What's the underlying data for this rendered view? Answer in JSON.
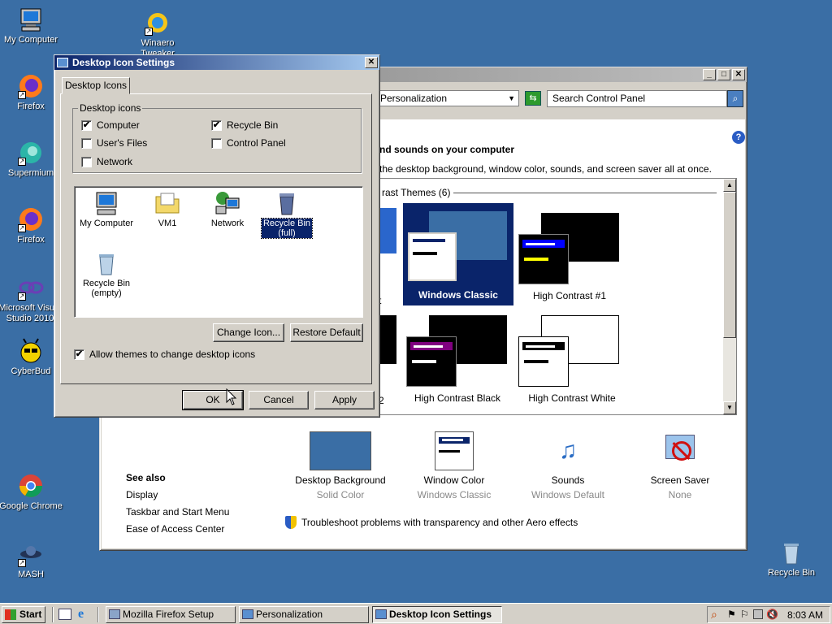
{
  "desktop": {
    "icons": [
      {
        "label": "My Computer"
      },
      {
        "label": "Winaero Tweaker"
      },
      {
        "label": "Firefox"
      },
      {
        "label": "Supermium"
      },
      {
        "label": "Firefox"
      },
      {
        "label": "Microsoft Visual Studio 2010"
      },
      {
        "label": "CyberBud"
      },
      {
        "label": "Google Chrome"
      },
      {
        "label": "MASH"
      },
      {
        "label": "Recycle Bin"
      }
    ]
  },
  "personalization": {
    "address": "Personalization",
    "search_placeholder": "Search Control Panel",
    "heading": "nd sounds on your computer",
    "subheading": "the desktop background, window color, sounds, and screen saver all at once.",
    "group_label": "rast Themes (6)",
    "themes": [
      {
        "label": "Windows Classic"
      },
      {
        "label": "High Contrast #1"
      },
      {
        "label": "High Contrast Black"
      },
      {
        "label": "High Contrast White"
      },
      {
        "label": "t"
      },
      {
        "label": "2"
      }
    ],
    "see_also": {
      "title": "See also",
      "links": [
        "Display",
        "Taskbar and Start Menu",
        "Ease of Access Center"
      ]
    },
    "settings": [
      {
        "label": "Desktop Background",
        "value": "Solid Color"
      },
      {
        "label": "Window Color",
        "value": "Windows Classic"
      },
      {
        "label": "Sounds",
        "value": "Windows Default"
      },
      {
        "label": "Screen Saver",
        "value": "None"
      }
    ],
    "troubleshoot": "Troubleshoot problems with transparency and other Aero effects"
  },
  "dialog": {
    "title": "Desktop Icon Settings",
    "tab": "Desktop Icons",
    "group_title": "Desktop icons",
    "checkboxes": [
      {
        "label": "Computer",
        "checked": "✔"
      },
      {
        "label": "Recycle Bin",
        "checked": "✔"
      },
      {
        "label": "User's Files",
        "checked": ""
      },
      {
        "label": "Control Panel",
        "checked": ""
      },
      {
        "label": "Network",
        "checked": ""
      }
    ],
    "preview_icons": [
      {
        "label": "My Computer"
      },
      {
        "label": "VM1"
      },
      {
        "label": "Network"
      },
      {
        "label": "Recycle Bin (full)"
      },
      {
        "label": "Recycle Bin (empty)"
      }
    ],
    "change_icon": "Change Icon...",
    "restore_default": "Restore Default",
    "allow_themes": "Allow themes to change desktop icons",
    "allow_checked": "✔",
    "ok": "OK",
    "cancel": "Cancel",
    "apply": "Apply"
  },
  "taskbar": {
    "start": "Start",
    "tasks": [
      {
        "label": "Mozilla Firefox Setup"
      },
      {
        "label": "Personalization"
      },
      {
        "label": "Desktop Icon Settings"
      }
    ],
    "clock": "8:03 AM"
  },
  "colors": {
    "desktop": "#3a6ea5",
    "title_active": "#0a246a",
    "selection": "#0a246a"
  }
}
